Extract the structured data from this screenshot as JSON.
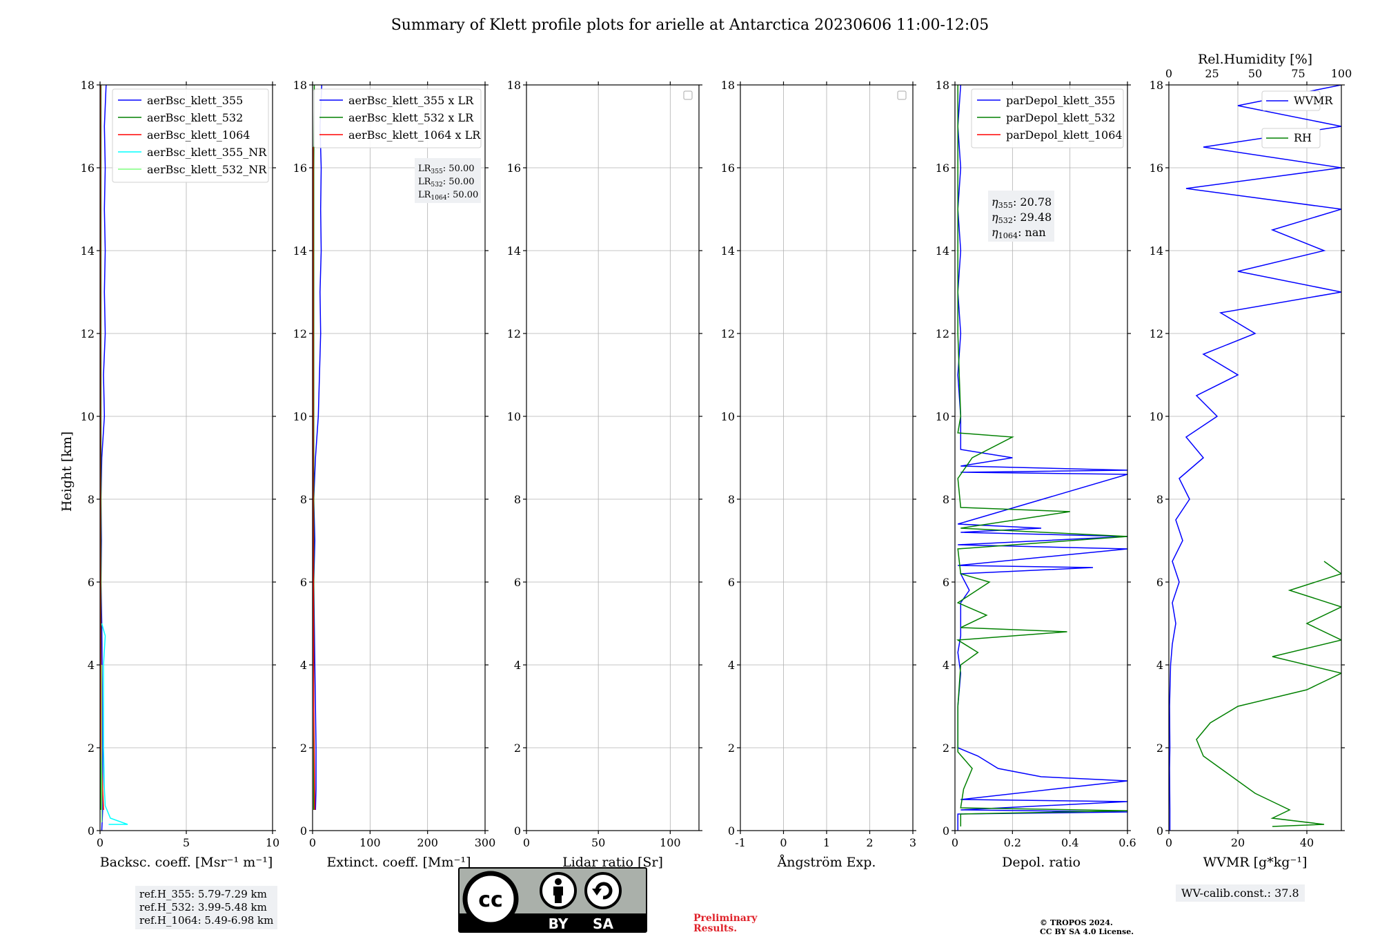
{
  "figure": {
    "title": "Summary of Klett profile plots for arielle at Antarctica 20230606 11:00-12:05",
    "ylabel": "Height [km]"
  },
  "info": {
    "ref_lines": [
      "ref.H_355: 5.79-7.29 km",
      "ref.H_532: 3.99-5.48 km",
      "ref.H_1064: 5.49-6.98 km"
    ],
    "wv_calib": "WV-calib.const.: 37.8",
    "preliminary": [
      "Preliminary",
      "Results."
    ],
    "copyright": [
      "© TROPOS 2024.",
      "CC BY SA 4.0 License."
    ],
    "license_badge": {
      "by": "BY",
      "sa": "SA",
      "cc": "cc"
    }
  },
  "colors": {
    "c355": "#0000ff",
    "c532": "#008000",
    "c1064": "#ff0000",
    "c355nr": "#00ffff",
    "c532nr": "#7fff7f",
    "rh": "#008000",
    "wvmr": "#0000ff"
  },
  "chart_data": [
    {
      "id": "bsc",
      "type": "line",
      "xlabel": "Backsc. coeff. [Msr⁻¹ m⁻¹]",
      "xlim": [
        0,
        10
      ],
      "xticks": [
        0,
        5,
        10
      ],
      "ylim": [
        0,
        18
      ],
      "yticks": [
        0,
        2,
        4,
        6,
        8,
        10,
        12,
        14,
        16,
        18
      ],
      "legend": "top-right",
      "series": [
        {
          "name": "aerBsc_klett_355",
          "color": "#0000ff",
          "points": [
            [
              0.1,
              0
            ],
            [
              0.15,
              0.5
            ],
            [
              0.15,
              1
            ],
            [
              0.15,
              2
            ],
            [
              0.14,
              3
            ],
            [
              0.12,
              4
            ],
            [
              0.1,
              5
            ],
            [
              0.05,
              6
            ],
            [
              0.08,
              7
            ],
            [
              0.05,
              8
            ],
            [
              0.1,
              9
            ],
            [
              0.25,
              10
            ],
            [
              0.2,
              11
            ],
            [
              0.3,
              12
            ],
            [
              0.25,
              13
            ],
            [
              0.3,
              14
            ],
            [
              0.25,
              15
            ],
            [
              0.3,
              16
            ],
            [
              0.25,
              17
            ],
            [
              0.35,
              18
            ]
          ]
        },
        {
          "name": "aerBsc_klett_532",
          "color": "#008000",
          "points": [
            [
              0.05,
              0.5
            ],
            [
              0.05,
              3
            ],
            [
              0.05,
              6
            ],
            [
              0.05,
              10
            ],
            [
              0.05,
              14
            ],
            [
              0.05,
              18
            ]
          ]
        },
        {
          "name": "aerBsc_klett_1064",
          "color": "#ff0000",
          "points": [
            [
              0.2,
              0.5
            ],
            [
              0.05,
              2
            ],
            [
              0.02,
              6
            ],
            [
              0.02,
              10
            ],
            [
              0.02,
              14
            ],
            [
              0.02,
              18
            ]
          ]
        },
        {
          "name": "aerBsc_klett_355_NR",
          "color": "#00ffff",
          "points": [
            [
              0.5,
              0.15
            ],
            [
              1.6,
              0.15
            ],
            [
              0.6,
              0.3
            ],
            [
              0.3,
              0.6
            ],
            [
              0.25,
              1
            ],
            [
              0.2,
              2
            ],
            [
              0.2,
              3
            ],
            [
              0.2,
              4
            ],
            [
              0.3,
              4.7
            ],
            [
              0.1,
              5
            ]
          ]
        },
        {
          "name": "aerBsc_klett_532_NR",
          "color": "#7fff7f",
          "points": [
            [
              0.1,
              0.2
            ],
            [
              0.1,
              2
            ],
            [
              0.1,
              4
            ]
          ]
        }
      ]
    },
    {
      "id": "ext",
      "type": "line",
      "xlabel": "Extinct. coeff. [Mm⁻¹]",
      "xlim": [
        0,
        300
      ],
      "xticks": [
        0,
        100,
        200,
        300
      ],
      "ylim": [
        0,
        18
      ],
      "yticks": [
        0,
        2,
        4,
        6,
        8,
        10,
        12,
        14,
        16,
        18
      ],
      "legend": "top-right",
      "annotation": [
        {
          "base": "LR",
          "sub": "355",
          "rest": ": 50.00"
        },
        {
          "base": "LR",
          "sub": "532",
          "rest": ": 50.00"
        },
        {
          "base": "LR",
          "sub": "1064",
          "rest": ": 50.00"
        }
      ],
      "series": [
        {
          "name": "aerBsc_klett_355 x LR",
          "color": "#0000ff",
          "points": [
            [
              5,
              0.5
            ],
            [
              6,
              1
            ],
            [
              6,
              2
            ],
            [
              5,
              3
            ],
            [
              4,
              4
            ],
            [
              3,
              5
            ],
            [
              2,
              6
            ],
            [
              4,
              7
            ],
            [
              2,
              8
            ],
            [
              5,
              9
            ],
            [
              10,
              10
            ],
            [
              12,
              11
            ],
            [
              14,
              12
            ],
            [
              13,
              13
            ],
            [
              15,
              14
            ],
            [
              14,
              15
            ],
            [
              15,
              16
            ],
            [
              13,
              17
            ],
            [
              16,
              18
            ]
          ]
        },
        {
          "name": "aerBsc_klett_532 x LR",
          "color": "#008000",
          "points": [
            [
              2,
              0.5
            ],
            [
              2,
              4
            ],
            [
              2,
              8
            ],
            [
              2,
              12
            ],
            [
              2,
              16
            ],
            [
              3,
              18
            ]
          ]
        },
        {
          "name": "aerBsc_klett_1064 x LR",
          "color": "#ff0000",
          "points": [
            [
              4,
              0.5
            ],
            [
              2,
              3
            ],
            [
              1,
              8
            ],
            [
              1,
              12
            ],
            [
              1,
              16.5
            ]
          ]
        }
      ]
    },
    {
      "id": "lr",
      "type": "line",
      "xlabel": "Lidar ratio [Sr]",
      "xlim": [
        0,
        120
      ],
      "xticks": [
        0,
        50,
        100
      ],
      "ylim": [
        0,
        18
      ],
      "yticks": [
        0,
        2,
        4,
        6,
        8,
        10,
        12,
        14,
        16,
        18
      ],
      "legend": "top-right",
      "series": []
    },
    {
      "id": "ang",
      "type": "line",
      "xlabel": "Ångström Exp.",
      "xlim": [
        -1,
        3
      ],
      "xticks": [
        -1,
        0,
        1,
        2,
        3
      ],
      "ylim": [
        0,
        18
      ],
      "yticks": [
        0,
        2,
        4,
        6,
        8,
        10,
        12,
        14,
        16,
        18
      ],
      "legend": "top-right",
      "series": []
    },
    {
      "id": "depol",
      "type": "line",
      "xlabel": "Depol. ratio",
      "xlim": [
        0,
        0.6
      ],
      "xticks": [
        0.0,
        0.2,
        0.4,
        0.6
      ],
      "ylim": [
        0,
        18
      ],
      "yticks": [
        0,
        2,
        4,
        6,
        8,
        10,
        12,
        14,
        16,
        18
      ],
      "legend": "top-right",
      "annotation": [
        {
          "base": "η",
          "sub": "355",
          "rest": ": 20.78"
        },
        {
          "base": "η",
          "sub": "532",
          "rest": ": 29.48"
        },
        {
          "base": "η",
          "sub": "1064",
          "rest": ": nan"
        }
      ],
      "series": [
        {
          "name": "parDepol_klett_355",
          "color": "#0000ff",
          "points": [
            [
              0.01,
              0
            ],
            [
              0.01,
              0.4
            ],
            [
              0.6,
              0.45
            ],
            [
              0.02,
              0.5
            ],
            [
              0.6,
              0.7
            ],
            [
              0.02,
              0.75
            ],
            [
              0.6,
              1.2
            ],
            [
              0.3,
              1.3
            ],
            [
              0.15,
              1.5
            ],
            [
              0.08,
              1.8
            ],
            [
              0.01,
              2.0
            ],
            [
              0.01,
              3
            ],
            [
              0.02,
              3.8
            ],
            [
              0.01,
              4.3
            ],
            [
              0.02,
              4.7
            ],
            [
              0.02,
              5.5
            ],
            [
              0.05,
              5.8
            ],
            [
              0.02,
              6.2
            ],
            [
              0.48,
              6.35
            ],
            [
              0.01,
              6.4
            ],
            [
              0.6,
              6.8
            ],
            [
              0.01,
              6.9
            ],
            [
              0.6,
              7.1
            ],
            [
              0.02,
              7.2
            ],
            [
              0.3,
              7.3
            ],
            [
              0.01,
              7.4
            ],
            [
              0.6,
              8.6
            ],
            [
              0.02,
              8.65
            ],
            [
              0.6,
              8.7
            ],
            [
              0.02,
              8.8
            ],
            [
              0.2,
              9.0
            ],
            [
              0.02,
              9.2
            ],
            [
              0.02,
              10
            ],
            [
              0.01,
              11
            ],
            [
              0.02,
              12
            ],
            [
              0.01,
              13
            ],
            [
              0.02,
              14
            ],
            [
              0.01,
              15
            ],
            [
              0.02,
              16
            ],
            [
              0.01,
              17
            ],
            [
              0.02,
              18
            ]
          ]
        },
        {
          "name": "parDepol_klett_532",
          "color": "#008000",
          "points": [
            [
              0.02,
              0.1
            ],
            [
              0.02,
              0.4
            ],
            [
              0.6,
              0.48
            ],
            [
              0.02,
              0.55
            ],
            [
              0.03,
              1
            ],
            [
              0.06,
              1.5
            ],
            [
              0.01,
              1.9
            ],
            [
              0.01,
              3
            ],
            [
              0.02,
              4
            ],
            [
              0.08,
              4.3
            ],
            [
              0.01,
              4.6
            ],
            [
              0.39,
              4.8
            ],
            [
              0.02,
              4.9
            ],
            [
              0.11,
              5.2
            ],
            [
              0.01,
              5.5
            ],
            [
              0.12,
              6.0
            ],
            [
              0.02,
              6.2
            ],
            [
              0.01,
              6.8
            ],
            [
              0.6,
              7.1
            ],
            [
              0.02,
              7.3
            ],
            [
              0.4,
              7.7
            ],
            [
              0.02,
              7.8
            ],
            [
              0.01,
              8.5
            ],
            [
              0.06,
              9
            ],
            [
              0.2,
              9.5
            ],
            [
              0.01,
              9.6
            ],
            [
              0.02,
              10
            ],
            [
              0.01,
              12
            ],
            [
              0.01,
              14
            ],
            [
              0.01,
              16
            ],
            [
              0.01,
              18
            ]
          ]
        },
        {
          "name": "parDepol_klett_1064",
          "color": "#ff0000",
          "points": []
        }
      ]
    },
    {
      "id": "wv",
      "type": "line",
      "xlabel": "WVMR [g*kg⁻¹]",
      "xlim": [
        0,
        50
      ],
      "xticks": [
        0,
        20,
        40
      ],
      "top_xlabel": "Rel.Humidity [%]",
      "top_xlim": [
        0,
        100
      ],
      "top_xticks": [
        0,
        25,
        50,
        75,
        100
      ],
      "ylim": [
        0,
        18
      ],
      "yticks": [
        0,
        2,
        4,
        6,
        8,
        10,
        12,
        14,
        16,
        18
      ],
      "legend": "top-right",
      "series": [
        {
          "name": "WVMR",
          "color": "#0000ff",
          "points": [
            [
              0.3,
              0
            ],
            [
              0.3,
              0.5
            ],
            [
              0.2,
              1.5
            ],
            [
              0.3,
              2
            ],
            [
              0.2,
              3
            ],
            [
              0.5,
              4
            ],
            [
              1,
              4.5
            ],
            [
              2,
              5
            ],
            [
              1,
              5.5
            ],
            [
              3,
              6
            ],
            [
              1,
              6.5
            ],
            [
              4,
              7
            ],
            [
              2,
              7.5
            ],
            [
              6,
              8
            ],
            [
              3,
              8.5
            ],
            [
              10,
              9
            ],
            [
              5,
              9.5
            ],
            [
              14,
              10
            ],
            [
              8,
              10.5
            ],
            [
              20,
              11
            ],
            [
              10,
              11.5
            ],
            [
              25,
              12
            ],
            [
              15,
              12.5
            ],
            [
              50,
              13
            ],
            [
              20,
              13.5
            ],
            [
              45,
              14
            ],
            [
              30,
              14.5
            ],
            [
              50,
              15
            ],
            [
              5,
              15.5
            ],
            [
              50,
              16
            ],
            [
              10,
              16.5
            ],
            [
              50,
              17
            ],
            [
              20,
              17.5
            ],
            [
              50,
              18
            ]
          ]
        },
        {
          "name": "RH",
          "color": "#008000",
          "points": [
            [
              30,
              0.1
            ],
            [
              45,
              0.15
            ],
            [
              30,
              0.3
            ],
            [
              35,
              0.5
            ],
            [
              30,
              0.7
            ],
            [
              25,
              0.9
            ],
            [
              20,
              1.2
            ],
            [
              15,
              1.5
            ],
            [
              10,
              1.8
            ],
            [
              8,
              2.2
            ],
            [
              12,
              2.6
            ],
            [
              20,
              3
            ],
            [
              40,
              3.4
            ],
            [
              50,
              3.8
            ],
            [
              30,
              4.2
            ],
            [
              50,
              4.6
            ],
            [
              40,
              5
            ],
            [
              50,
              5.4
            ],
            [
              35,
              5.8
            ],
            [
              50,
              6.2
            ],
            [
              45,
              6.5
            ]
          ]
        }
      ]
    }
  ]
}
